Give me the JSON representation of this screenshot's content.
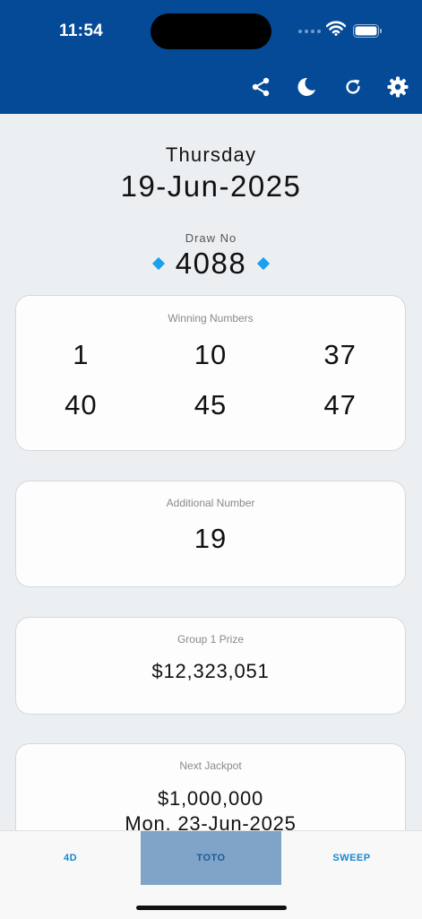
{
  "status": {
    "time": "11:54"
  },
  "toolbar": {
    "icons": [
      "share-icon",
      "moon-icon",
      "refresh-icon",
      "gear-icon"
    ]
  },
  "draw": {
    "day": "Thursday",
    "date": "19-Jun-2025",
    "label": "Draw No",
    "number": "4088"
  },
  "winning": {
    "title": "Winning Numbers",
    "numbers": [
      "1",
      "10",
      "37",
      "40",
      "45",
      "47"
    ]
  },
  "additional": {
    "title": "Additional Number",
    "value": "19"
  },
  "group1": {
    "title": "Group 1 Prize",
    "value": "$12,323,051"
  },
  "jackpot": {
    "title": "Next Jackpot",
    "amount": "$1,000,000",
    "date": "Mon, 23-Jun-2025"
  },
  "tabs": [
    {
      "label": "4D",
      "active": false
    },
    {
      "label": "TOTO",
      "active": true
    },
    {
      "label": "SWEEP",
      "active": false
    }
  ],
  "colors": {
    "header": "#054a97",
    "accent": "#1aa0f0",
    "active_tab": "#7fa4c7"
  }
}
